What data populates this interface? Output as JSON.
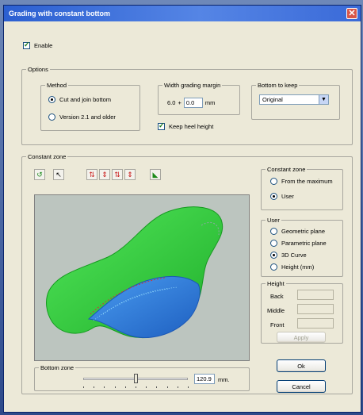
{
  "window": {
    "title": "Grading with constant bottom",
    "close_glyph": "✕"
  },
  "enable": {
    "label": "Enable",
    "checked": true
  },
  "options": {
    "legend": "Options",
    "method": {
      "legend": "Method",
      "items": [
        {
          "label": "Cut and join bottom",
          "selected": true
        },
        {
          "label": "Version 2.1 and older",
          "selected": false
        }
      ]
    },
    "width_grading_margin": {
      "legend": "Width grading margin",
      "base": "6.0",
      "plus": "+",
      "value": "0.0",
      "unit": "mm"
    },
    "bottom_to_keep": {
      "legend": "Bottom to keep",
      "selected": "Original"
    },
    "keep_heel_height": {
      "label": "Keep heel height",
      "checked": true
    }
  },
  "constant_zone": {
    "legend": "Constant zone",
    "tools": [
      {
        "icon": "rotate-view-icon",
        "glyph": "↺"
      },
      {
        "icon": "select-pointer-icon",
        "glyph": "↖"
      },
      {
        "icon": "split-arrows-icon-1",
        "glyph": "⇅"
      },
      {
        "icon": "split-arrows-icon-2",
        "glyph": "⇕"
      },
      {
        "icon": "split-arrows-icon-3",
        "glyph": "⇅"
      },
      {
        "icon": "split-arrows-icon-4",
        "glyph": "⇕"
      },
      {
        "icon": "shoe-view-icon",
        "glyph": "◣"
      }
    ],
    "mode": {
      "legend": "Constant zone",
      "items": [
        {
          "label": "From the maximum",
          "selected": false
        },
        {
          "label": "User",
          "selected": true
        }
      ]
    },
    "user": {
      "legend": "User",
      "items": [
        {
          "label": "Geometric plane",
          "selected": false
        },
        {
          "label": "Parametric plane",
          "selected": false
        },
        {
          "label": "3D Curve",
          "selected": true
        },
        {
          "label": "Height (mm)",
          "selected": false
        }
      ]
    },
    "height": {
      "legend": "Height",
      "back": "Back",
      "middle": "Middle",
      "front": "Front",
      "apply": "Apply"
    }
  },
  "bottom_zone": {
    "legend": "Bottom zone",
    "value": "120.9",
    "unit": "mm.",
    "slider_fraction": 0.5
  },
  "buttons": {
    "ok": "Ok",
    "cancel": "Cancel"
  },
  "colors": {
    "shoe_green": "#2fd33a",
    "shoe_blue": "#2d7fe0",
    "viewport_bg": "#bcc5bf"
  }
}
